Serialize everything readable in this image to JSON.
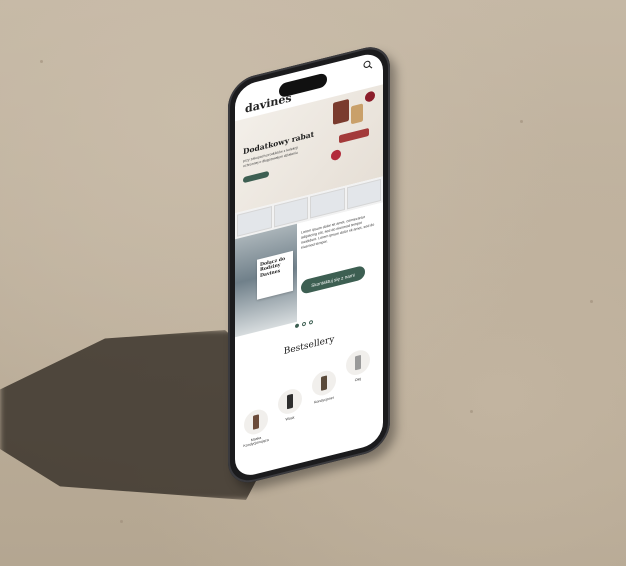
{
  "header": {
    "brand": "davines"
  },
  "hero": {
    "title": "Dodatkowy rabat",
    "subtitle": "przy zakupach produktów z kolekcji ochronnej o długotrwałym działaniu",
    "cta_label": ""
  },
  "promo": {
    "card_title": "Dołącz do Rodziny Davines",
    "text": "Lorem ipsum dolor sit amet, consectetur adipiscing elit, sed do eiusmod tempor incididunt. Lorem ipsum dolor sit amet, sed do eiusmod tempor.",
    "cta_label": "Skontaktuj się z nami"
  },
  "carousel": {
    "count": 3,
    "active": 0
  },
  "bestsellers": {
    "title": "Bestsellery",
    "items": [
      {
        "label": "Maska Kondycjonująca"
      },
      {
        "label": "Wosk"
      },
      {
        "label": "Kondycjoner"
      },
      {
        "label": "Olej"
      }
    ]
  },
  "colors": {
    "accent": "#3d5f52",
    "phone_frame": "#1b1b1d",
    "background": "#b8ab98"
  },
  "icons": {
    "search": "search-icon"
  }
}
